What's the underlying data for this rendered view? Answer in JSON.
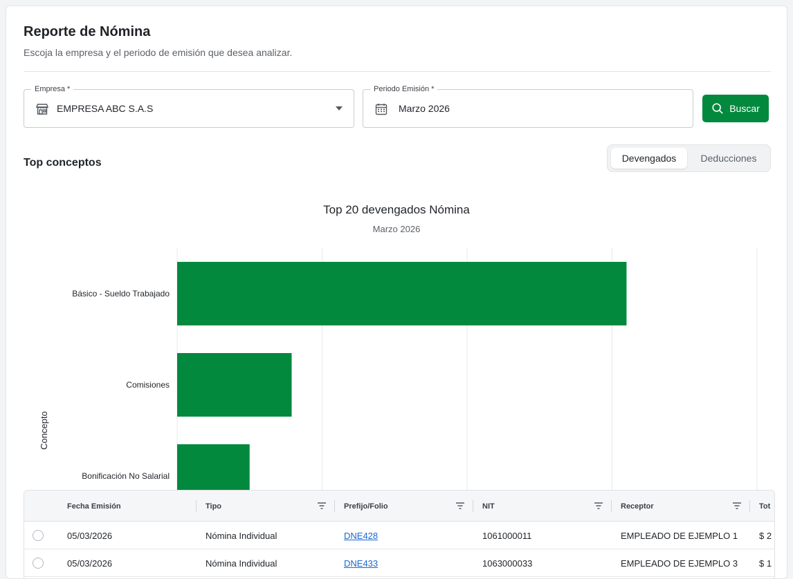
{
  "header": {
    "title": "Reporte de Nómina",
    "subtitle": "Escoja la empresa y el periodo de emisión que desea analizar."
  },
  "filters": {
    "company_label": "Empresa",
    "company_required": "*",
    "company_value": "EMPRESA ABC S.A.S",
    "period_label": "Periodo Emisión",
    "period_required": "*",
    "period_value": "Marzo 2026",
    "search_button": "Buscar"
  },
  "section": {
    "title": "Top conceptos",
    "tabs": [
      {
        "label": "Devengados",
        "active": true
      },
      {
        "label": "Deducciones",
        "active": false
      }
    ]
  },
  "chart_data": {
    "type": "bar",
    "orientation": "horizontal",
    "title": "Top 20 devengados Nómina",
    "subtitle": "Marzo 2026",
    "ylabel": "Concepto",
    "categories": [
      "Básico - Sueldo Trabajado",
      "Comisiones",
      "Bonificación No Salarial"
    ],
    "values": [
      3.1,
      0.79,
      0.5
    ],
    "xlim": [
      0,
      4
    ],
    "grid": true,
    "bar_color": "#03893d"
  },
  "table": {
    "columns": [
      "Fecha Emisión",
      "Tipo",
      "Prefijo/Folio",
      "NIT",
      "Receptor",
      "Tot"
    ],
    "rows": [
      {
        "fecha": "05/03/2026",
        "tipo": "Nómina Individual",
        "folio": "DNE428",
        "nit": "1061000011",
        "receptor": "EMPLEADO DE EJEMPLO 1",
        "total": "$ 2"
      },
      {
        "fecha": "05/03/2026",
        "tipo": "Nómina Individual",
        "folio": "DNE433",
        "nit": "1063000033",
        "receptor": "EMPLEADO DE EJEMPLO 3",
        "total": "$ 1"
      }
    ]
  },
  "colors": {
    "primary": "#03893d",
    "link": "#1a66d2"
  }
}
